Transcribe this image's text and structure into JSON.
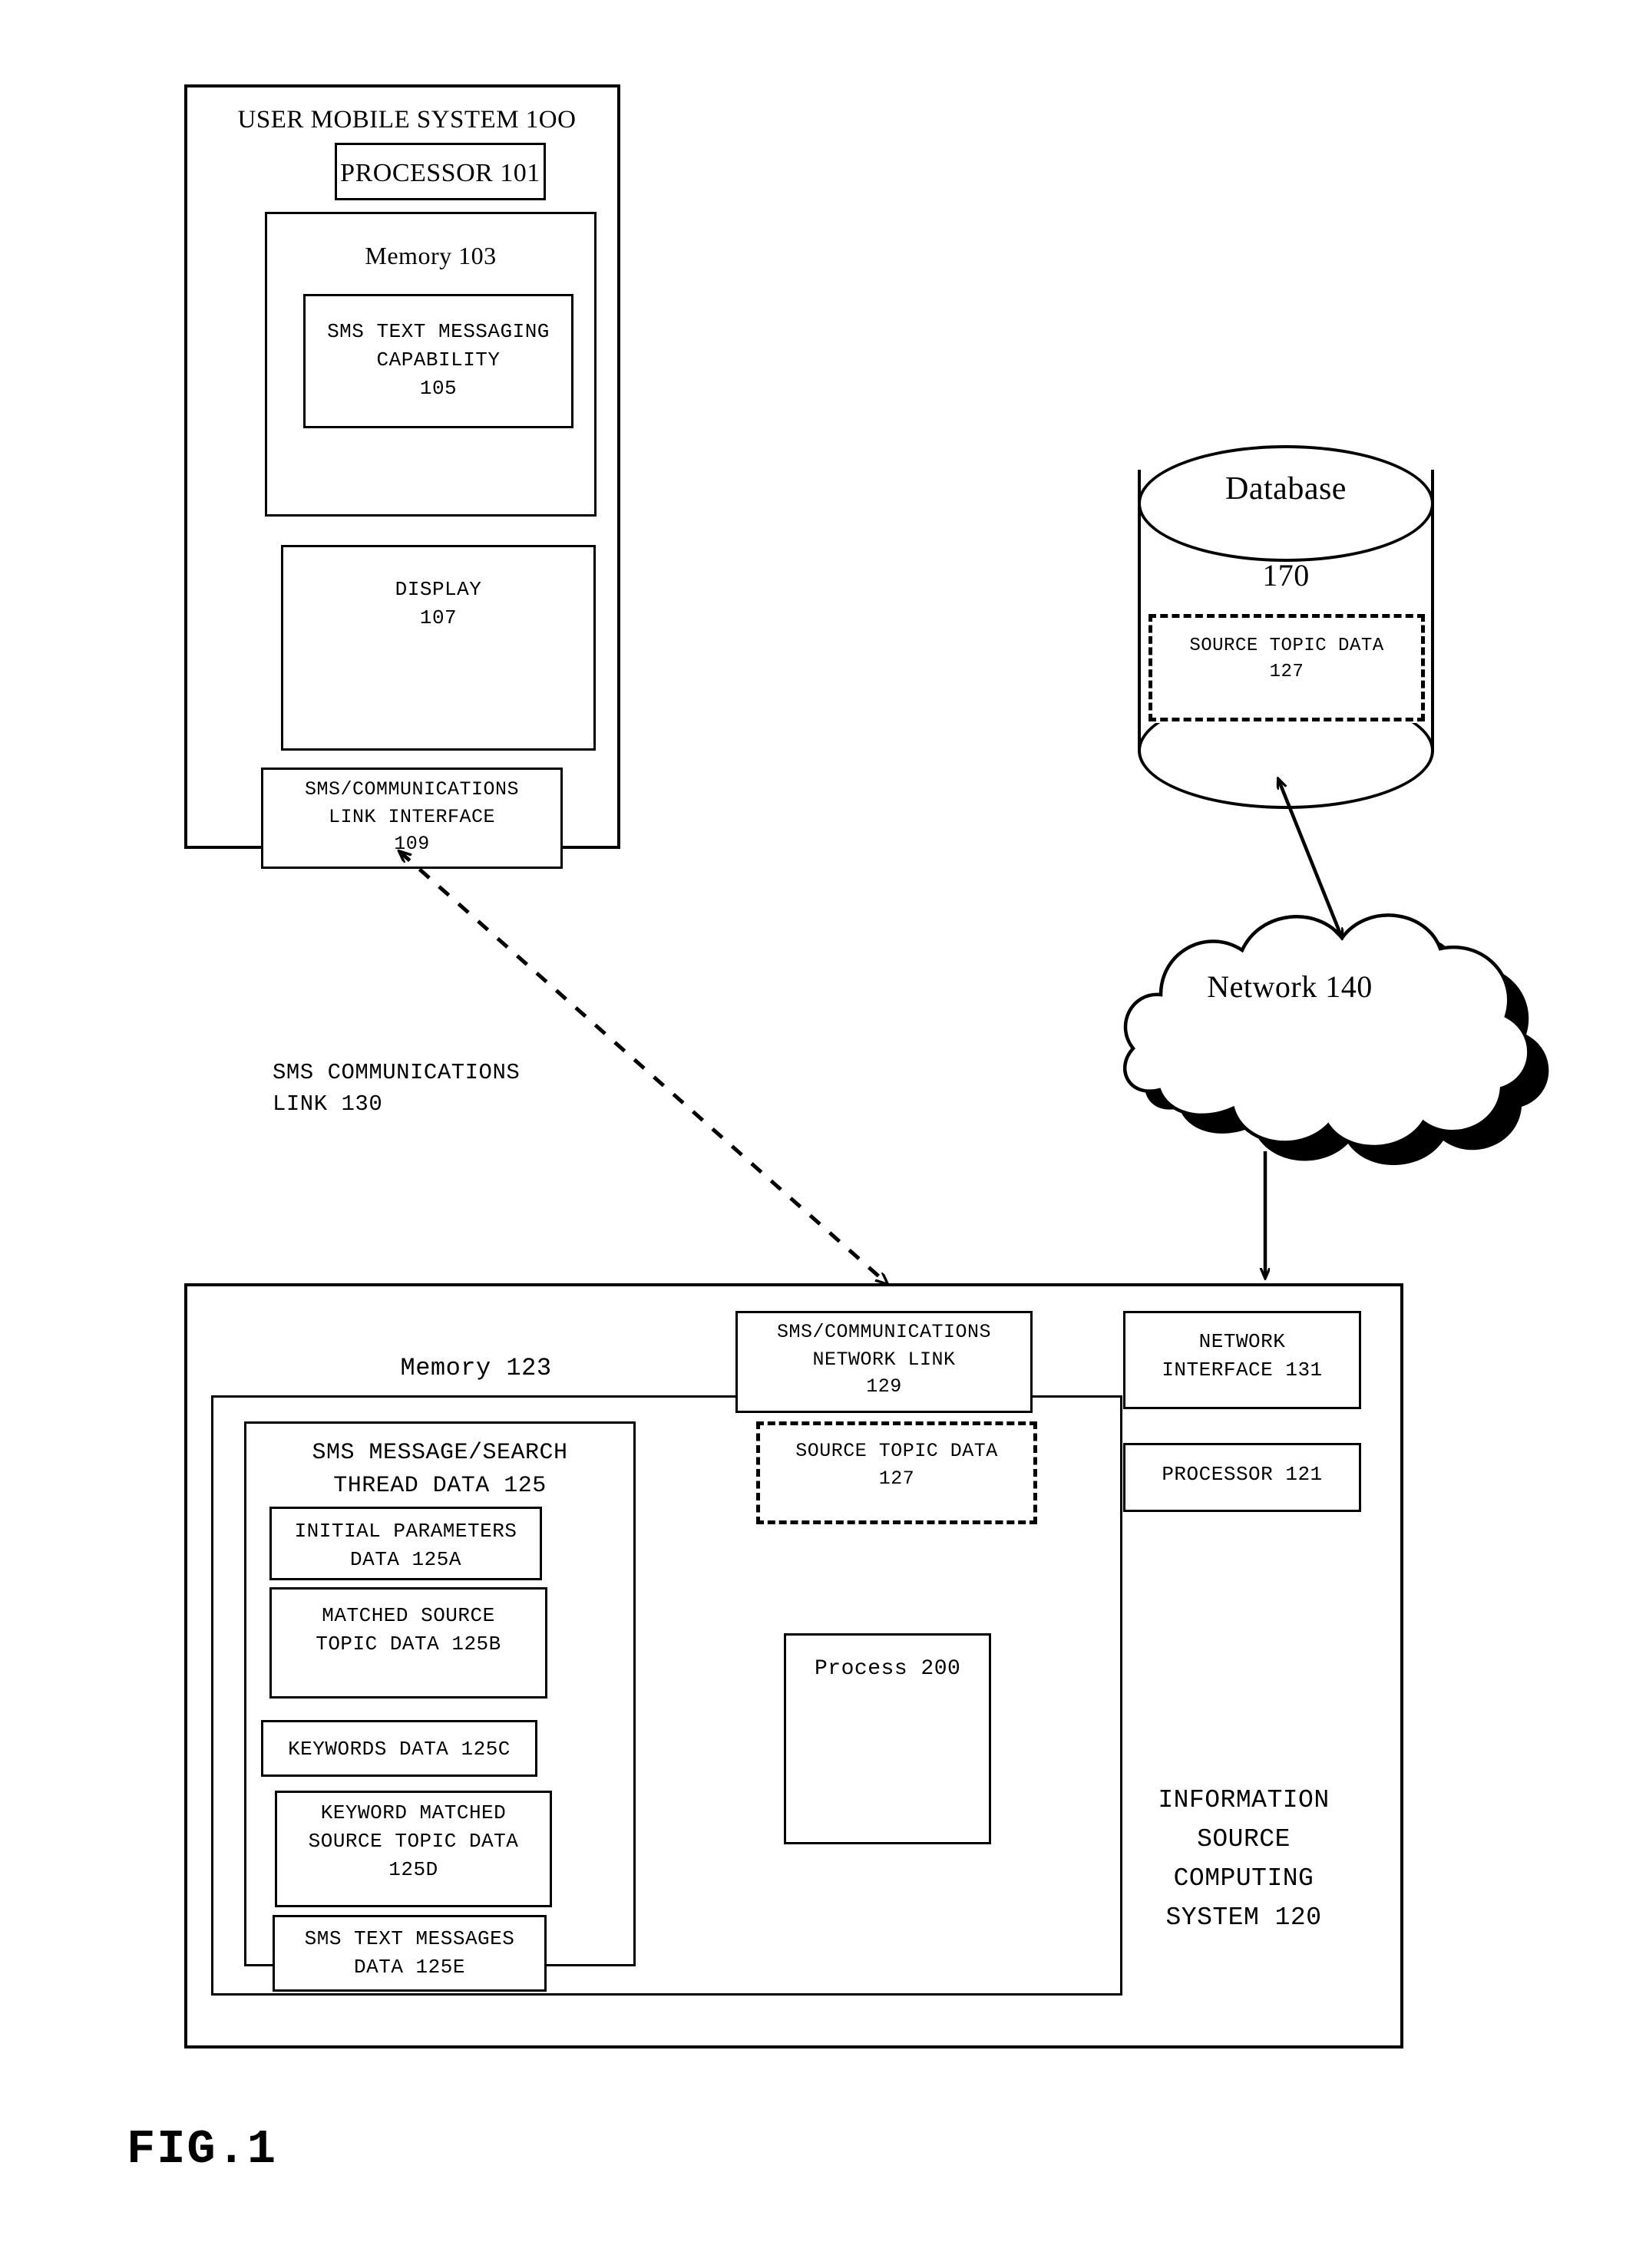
{
  "figure": {
    "caption": "FIG.1"
  },
  "user_mobile_system": {
    "title": "USER MOBILE SYSTEM 1OO",
    "processor": "PROCESSOR 101",
    "memory": {
      "title": "Memory 103",
      "sms_capability": "SMS TEXT MESSAGING\nCAPABILITY\n105"
    },
    "display": "DISPLAY\n107",
    "link_interface": "SMS/COMMUNICATIONS\nLINK INTERFACE\n109"
  },
  "sms_link_label": "SMS COMMUNICATIONS\nLINK 130",
  "database": {
    "title": "Database",
    "number": "170",
    "source_topic_data": "SOURCE TOPIC DATA\n127"
  },
  "network": {
    "label": "Network 140"
  },
  "information_source_system": {
    "title": "INFORMATION\nSOURCE\nCOMPUTING\nSYSTEM 120",
    "memory_title": "Memory  123",
    "thread_data_title": "SMS MESSAGE/SEARCH\nTHREAD DATA 125",
    "thread_items": [
      {
        "label": "INITIAL PARAMETERS\nDATA 125A"
      },
      {
        "label": "MATCHED SOURCE\nTOPIC DATA 125B"
      },
      {
        "label": "KEYWORDS DATA 125C"
      },
      {
        "label": "KEYWORD MATCHED\nSOURCE TOPIC DATA\n125D"
      },
      {
        "label": "SMS TEXT MESSAGES\nDATA 125E"
      }
    ],
    "source_topic_data": "SOURCE TOPIC DATA\n127",
    "process": "Process 200",
    "network_link": "SMS/COMMUNICATIONS\nNETWORK LINK\n129",
    "network_interface": "NETWORK\nINTERFACE 131",
    "processor": "PROCESSOR  121"
  },
  "colors": {
    "line": "#000000",
    "background": "#ffffff"
  }
}
